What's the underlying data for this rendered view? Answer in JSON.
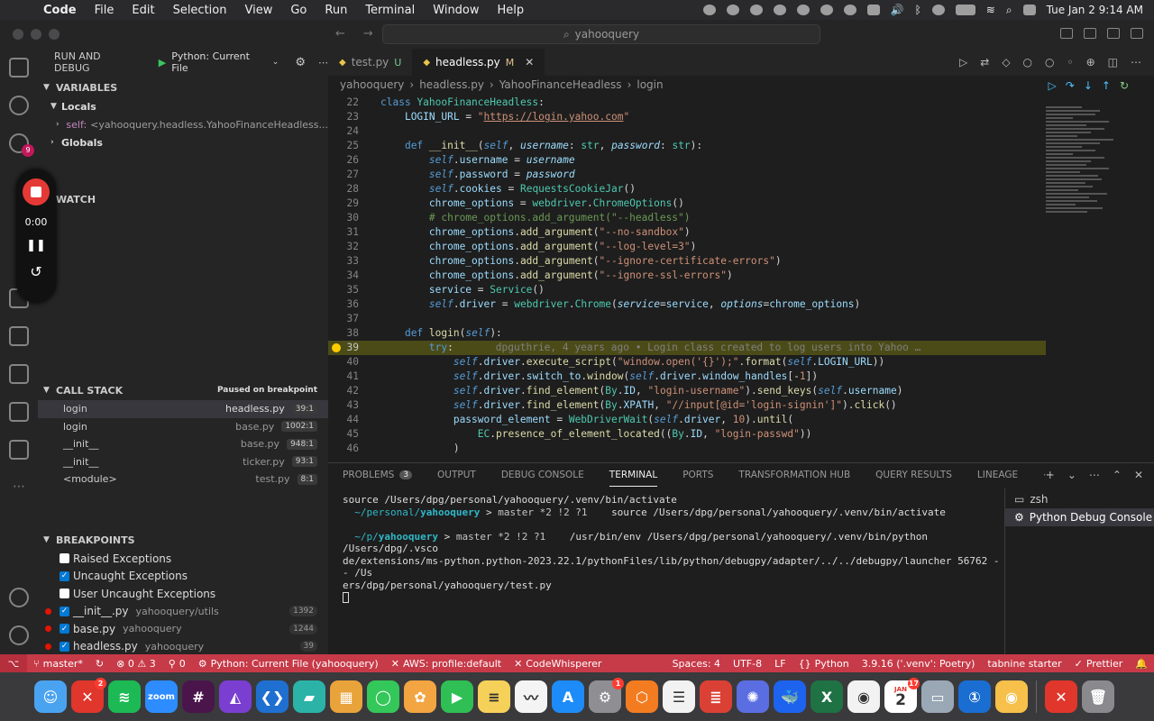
{
  "menubar": {
    "app_name": "Code",
    "menus": [
      "File",
      "Edit",
      "Selection",
      "View",
      "Go",
      "Run",
      "Terminal",
      "Window",
      "Help"
    ],
    "clock": "Tue Jan 2  9:14 AM"
  },
  "titlebar": {
    "search": "yahooquery"
  },
  "activity": {
    "scm_badge": "9"
  },
  "recorder": {
    "time": "0:00"
  },
  "sidebar": {
    "title": "RUN AND DEBUG",
    "config": "Python: Current File",
    "variables_title": "VARIABLES",
    "locals_label": "Locals",
    "self_name": "self:",
    "self_value": "<yahooquery.headless.YahooFinanceHeadless...",
    "globals_label": "Globals",
    "watch_title": "WATCH",
    "callstack_title": "CALL STACK",
    "callstack_status": "Paused on breakpoint",
    "stack": [
      {
        "fn": "login",
        "file": "headless.py",
        "pos": "39:1"
      },
      {
        "fn": "login",
        "file": "base.py",
        "pos": "1002:1"
      },
      {
        "fn": "__init__",
        "file": "base.py",
        "pos": "948:1"
      },
      {
        "fn": "__init__",
        "file": "ticker.py",
        "pos": "93:1"
      },
      {
        "fn": "<module>",
        "file": "test.py",
        "pos": "8:1"
      }
    ],
    "breakpoints_title": "BREAKPOINTS",
    "breakpoints": [
      {
        "label": "Raised Exceptions",
        "checked": false,
        "dot": false,
        "path": "",
        "count": ""
      },
      {
        "label": "Uncaught Exceptions",
        "checked": true,
        "dot": false,
        "path": "",
        "count": ""
      },
      {
        "label": "User Uncaught Exceptions",
        "checked": false,
        "dot": false,
        "path": "",
        "count": ""
      },
      {
        "label": "__init__.py",
        "checked": true,
        "dot": true,
        "path": "yahooquery/utils",
        "count": "1392"
      },
      {
        "label": "base.py",
        "checked": true,
        "dot": true,
        "path": "yahooquery",
        "count": "1244"
      },
      {
        "label": "headless.py",
        "checked": true,
        "dot": true,
        "path": "yahooquery",
        "count": "39"
      }
    ]
  },
  "editor": {
    "tabs": [
      {
        "name": "test.py",
        "flag": "U",
        "active": false
      },
      {
        "name": "headless.py",
        "flag": "M",
        "active": true
      }
    ],
    "breadcrumb": [
      "yahooquery",
      "headless.py",
      "YahooFinanceHeadless",
      "login"
    ],
    "lines": [
      {
        "n": "22",
        "h": "<span class='kw'>class</span> <span class='cls'>YahooFinanceHeadless</span>:"
      },
      {
        "n": "23",
        "h": "    <span class='var'>LOGIN_URL</span> = <span class='str'>\"<span class='underline'>https://login.yahoo.com</span>\"</span>"
      },
      {
        "n": "24",
        "h": ""
      },
      {
        "n": "25",
        "h": "    <span class='kw'>def</span> <span class='fn'>__init__</span>(<span class='self'>self</span>, <span class='param'>username</span>: <span class='cls'>str</span>, <span class='param'>password</span>: <span class='cls'>str</span>):"
      },
      {
        "n": "26",
        "h": "        <span class='self'>self</span>.<span class='var'>username</span> = <span class='param'>username</span>"
      },
      {
        "n": "27",
        "h": "        <span class='self'>self</span>.<span class='var'>password</span> = <span class='param'>password</span>"
      },
      {
        "n": "28",
        "h": "        <span class='self'>self</span>.<span class='var'>cookies</span> = <span class='cls'>RequestsCookieJar</span>()"
      },
      {
        "n": "29",
        "h": "        <span class='var'>chrome_options</span> = <span class='cls'>webdriver</span>.<span class='cls'>ChromeOptions</span>()"
      },
      {
        "n": "30",
        "h": "        <span class='cmt'># chrome_options.add_argument(\"--headless\")</span>"
      },
      {
        "n": "31",
        "h": "        <span class='var'>chrome_options</span>.<span class='fn'>add_argument</span>(<span class='str'>\"--no-sandbox\"</span>)"
      },
      {
        "n": "32",
        "h": "        <span class='var'>chrome_options</span>.<span class='fn'>add_argument</span>(<span class='str'>\"--log-level=3\"</span>)"
      },
      {
        "n": "33",
        "h": "        <span class='var'>chrome_options</span>.<span class='fn'>add_argument</span>(<span class='str'>\"--ignore-certificate-errors\"</span>)"
      },
      {
        "n": "34",
        "h": "        <span class='var'>chrome_options</span>.<span class='fn'>add_argument</span>(<span class='str'>\"--ignore-ssl-errors\"</span>)"
      },
      {
        "n": "35",
        "h": "        <span class='var'>service</span> = <span class='cls'>Service</span>()"
      },
      {
        "n": "36",
        "h": "        <span class='self'>self</span>.<span class='var'>driver</span> = <span class='cls'>webdriver</span>.<span class='cls'>Chrome</span>(<span class='param'>service</span>=<span class='var'>service</span>, <span class='param'>options</span>=<span class='var'>chrome_options</span>)"
      },
      {
        "n": "37",
        "h": ""
      },
      {
        "n": "38",
        "h": "    <span class='kw'>def</span> <span class='fn'>login</span>(<span class='self'>self</span>):"
      },
      {
        "n": "39",
        "h": "        <span class='kw'>try</span>:<span class='blame'>    dpguthrie, 4 years ago • Login class created to log users into Yahoo …</span>",
        "current": true
      },
      {
        "n": "40",
        "h": "            <span class='self'>self</span>.<span class='var'>driver</span>.<span class='fn'>execute_script</span>(<span class='str'>\"window.open('{}');\"</span>.<span class='fn'>format</span>(<span class='self'>self</span>.<span class='var'>LOGIN_URL</span>))"
      },
      {
        "n": "41",
        "h": "            <span class='self'>self</span>.<span class='var'>driver</span>.<span class='var'>switch_to</span>.<span class='fn'>window</span>(<span class='self'>self</span>.<span class='var'>driver</span>.<span class='var'>window_handles</span>[-<span class='str'>1</span>])"
      },
      {
        "n": "42",
        "h": "            <span class='self'>self</span>.<span class='var'>driver</span>.<span class='fn'>find_element</span>(<span class='cls'>By</span>.<span class='var'>ID</span>, <span class='str'>\"login-username\"</span>).<span class='fn'>send_keys</span>(<span class='self'>self</span>.<span class='var'>username</span>)"
      },
      {
        "n": "43",
        "h": "            <span class='self'>self</span>.<span class='var'>driver</span>.<span class='fn'>find_element</span>(<span class='cls'>By</span>.<span class='var'>XPATH</span>, <span class='str'>\"//input[@id='login-signin']\"</span>).<span class='fn'>click</span>()"
      },
      {
        "n": "44",
        "h": "            <span class='var'>password_element</span> = <span class='cls'>WebDriverWait</span>(<span class='self'>self</span>.<span class='var'>driver</span>, <span class='str'>10</span>).<span class='fn'>until</span>("
      },
      {
        "n": "45",
        "h": "                <span class='cls'>EC</span>.<span class='fn'>presence_of_element_located</span>((<span class='cls'>By</span>.<span class='var'>ID</span>, <span class='str'>\"login-passwd\"</span>))"
      },
      {
        "n": "46",
        "h": "            )"
      }
    ]
  },
  "panel": {
    "tabs": [
      {
        "label": "PROBLEMS",
        "count": "3",
        "active": false
      },
      {
        "label": "OUTPUT",
        "count": "",
        "active": false
      },
      {
        "label": "DEBUG CONSOLE",
        "count": "",
        "active": false
      },
      {
        "label": "TERMINAL",
        "count": "",
        "active": true
      },
      {
        "label": "PORTS",
        "count": "",
        "active": false
      },
      {
        "label": "TRANSFORMATION HUB",
        "count": "",
        "active": false
      },
      {
        "label": "QUERY RESULTS",
        "count": "",
        "active": false
      },
      {
        "label": "LINEAGE",
        "count": "",
        "active": false
      }
    ],
    "terminal": {
      "line1": "source /Users/dpg/personal/yahooquery/.venv/bin/activate",
      "p1_path": "~/personal/",
      "p1_bold": "yahooquery",
      "p1_git": "master *2 !2 ?1",
      "p1_cmd": "source /Users/dpg/personal/yahooquery/.venv/bin/activate",
      "p2_path": "~/p/",
      "p2_bold": "yahooquery",
      "p2_git": "master *2 !2 ?1",
      "p2_cmd1": "/usr/bin/env /Users/dpg/personal/yahooquery/.venv/bin/python /Users/dpg/.vsco",
      "p2_cmd2": "de/extensions/ms-python.python-2023.22.1/pythonFiles/lib/python/debugpy/adapter/../../debugpy/launcher 56762 -- /Us",
      "p2_cmd3": "ers/dpg/personal/yahooquery/test.py"
    },
    "terminals": [
      {
        "name": "zsh",
        "active": false
      },
      {
        "name": "Python Debug Console",
        "active": true
      }
    ]
  },
  "statusbar": {
    "branch": "master*",
    "problems": "⊗ 0 ⚠ 3",
    "ports": "0",
    "debug": "Python: Current File (yahooquery)",
    "aws": "AWS: profile:default",
    "codewhisperer": "CodeWhisperer",
    "spaces": "Spaces: 4",
    "encoding": "UTF-8",
    "eol": "LF",
    "language": "Python",
    "interpreter": "3.9.16 ('.venv': Poetry)",
    "tabnine": "tabnine starter",
    "prettier": "Prettier"
  },
  "dock": {
    "calendar_month": "JAN",
    "calendar_day": "2",
    "apps": [
      {
        "name": "finder-icon",
        "color": "#4aa3f0",
        "glyph": "☺",
        "badge": ""
      },
      {
        "name": "xmind-icon",
        "color": "#e0362c",
        "glyph": "✕",
        "badge": "2"
      },
      {
        "name": "spotify-icon",
        "color": "#1db954",
        "glyph": "≋",
        "badge": ""
      },
      {
        "name": "zoom-icon",
        "color": "#2d8cff",
        "glyph": "zoom",
        "badge": ""
      },
      {
        "name": "slack-icon",
        "color": "#4a154b",
        "glyph": "#",
        "badge": ""
      },
      {
        "name": "affinity-icon",
        "color": "#7a3fd1",
        "glyph": "◭",
        "badge": ""
      },
      {
        "name": "vscode-icon",
        "color": "#1f6fd0",
        "glyph": "❮❯",
        "badge": ""
      },
      {
        "name": "cursor-app-icon",
        "color": "#2bb3a8",
        "glyph": "▰",
        "badge": ""
      },
      {
        "name": "launchpad-icon",
        "color": "#e8a33a",
        "glyph": "▦",
        "badge": ""
      },
      {
        "name": "messages-icon",
        "color": "#34c759",
        "glyph": "◯",
        "badge": ""
      },
      {
        "name": "photos-icon",
        "color": "#f2a541",
        "glyph": "✿",
        "badge": ""
      },
      {
        "name": "facetime-icon",
        "color": "#2fbf55",
        "glyph": "▶",
        "badge": ""
      },
      {
        "name": "notes-icon",
        "color": "#f6d15a",
        "glyph": "≡",
        "badge": ""
      },
      {
        "name": "freeform-icon",
        "color": "#f4f4f4",
        "glyph": "〰",
        "badge": ""
      },
      {
        "name": "app-store-icon",
        "color": "#1d8cf8",
        "glyph": "A",
        "badge": ""
      },
      {
        "name": "system-settings-icon",
        "color": "#8e8e93",
        "glyph": "⚙",
        "badge": "1"
      },
      {
        "name": "backup-icon",
        "color": "#f47c20",
        "glyph": "⬡",
        "badge": ""
      },
      {
        "name": "reminders-icon",
        "color": "#f2f2f2",
        "glyph": "☰",
        "badge": ""
      },
      {
        "name": "todoist-icon",
        "color": "#db4035",
        "glyph": "≣",
        "badge": ""
      },
      {
        "name": "perplexity-icon",
        "color": "#5b6ee1",
        "glyph": "✺",
        "badge": ""
      },
      {
        "name": "docker-icon",
        "color": "#1d63ed",
        "glyph": "🐳",
        "badge": ""
      },
      {
        "name": "excel-icon",
        "color": "#1f7244",
        "glyph": "X",
        "badge": ""
      },
      {
        "name": "chrome-icon",
        "color": "#f2f2f2",
        "glyph": "◉",
        "badge": ""
      },
      {
        "name": "calendar-icon",
        "color": "#ffffff",
        "glyph": "",
        "badge": "17"
      },
      {
        "name": "preview-icon",
        "color": "#9aa7b5",
        "glyph": "▭",
        "badge": ""
      },
      {
        "name": "1password-icon",
        "color": "#1a6dd1",
        "glyph": "①",
        "badge": ""
      },
      {
        "name": "chrome-canary-icon",
        "color": "#f7c04a",
        "glyph": "◉",
        "badge": ""
      },
      {
        "name": "xmind-recent-icon",
        "color": "#e0362c",
        "glyph": "✕",
        "badge": ""
      },
      {
        "name": "trash-icon",
        "color": "#8a8a8e",
        "glyph": "🗑",
        "badge": ""
      }
    ]
  }
}
